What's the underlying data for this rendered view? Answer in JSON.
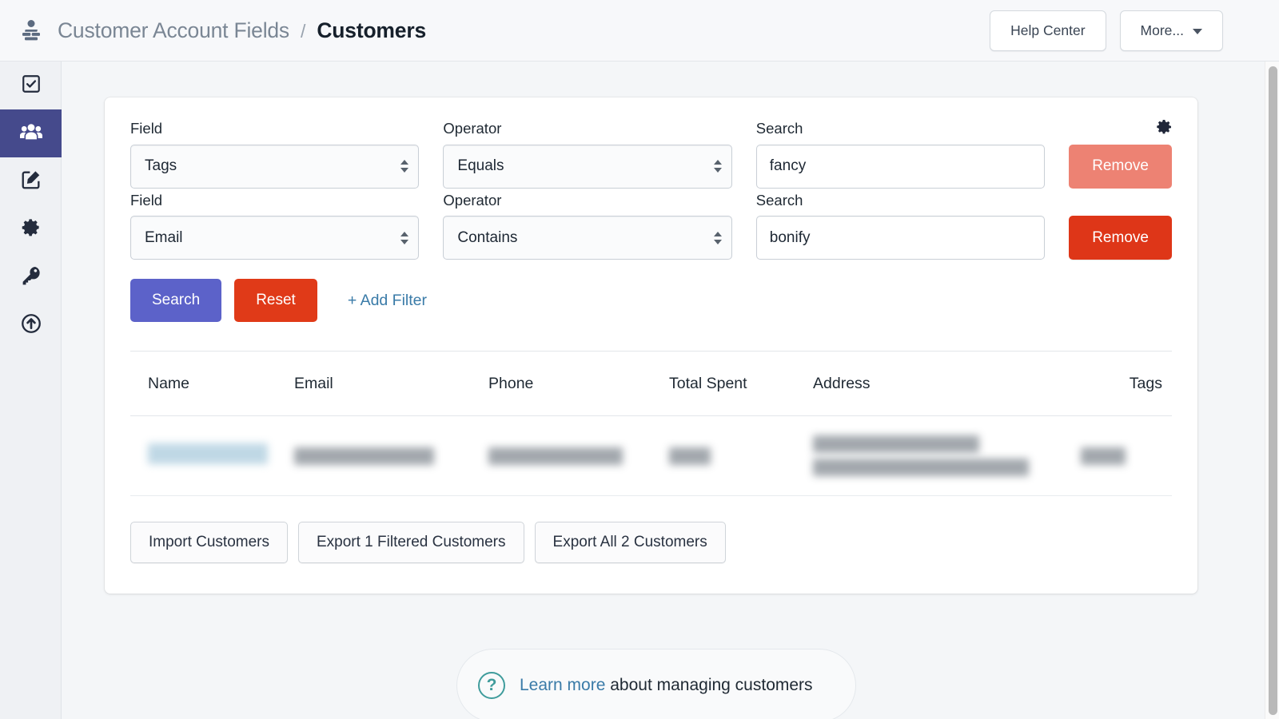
{
  "header": {
    "app_icon": "user-list-icon",
    "breadcrumb_parent": "Customer Account Fields",
    "breadcrumb_separator": "/",
    "breadcrumb_current": "Customers",
    "help_center_label": "Help Center",
    "more_label": "More...",
    "more_caret": "chevron-down-icon"
  },
  "sidebar": {
    "items": [
      {
        "name": "tasks",
        "icon": "checkbox-icon",
        "active": false
      },
      {
        "name": "customers",
        "icon": "people-icon",
        "active": true
      },
      {
        "name": "edit",
        "icon": "pencil-square-icon",
        "active": false
      },
      {
        "name": "settings",
        "icon": "gear-icon",
        "active": false
      },
      {
        "name": "permissions",
        "icon": "key-icon",
        "active": false
      },
      {
        "name": "upload",
        "icon": "upload-circle-icon",
        "active": false
      }
    ]
  },
  "card": {
    "settings_icon": "gear-icon",
    "labels": {
      "field": "Field",
      "operator": "Operator",
      "search": "Search"
    },
    "filters": [
      {
        "field_value": "Tags",
        "operator_value": "Equals",
        "search_value": "fancy",
        "remove_label": "Remove",
        "remove_style": "muted"
      },
      {
        "field_value": "Email",
        "operator_value": "Contains",
        "search_value": "bonify",
        "remove_label": "Remove",
        "remove_style": "strong"
      }
    ],
    "actions": {
      "search_label": "Search",
      "reset_label": "Reset",
      "add_filter_label": "+ Add Filter"
    },
    "table": {
      "columns": [
        "Name",
        "Email",
        "Phone",
        "Total Spent",
        "Address",
        "Tags"
      ],
      "rows": [
        {
          "name": "",
          "email": "",
          "phone": "",
          "total_spent": "",
          "address": "",
          "tags": "",
          "redacted": true
        }
      ]
    },
    "bottom_actions": [
      "Import Customers",
      "Export 1 Filtered Customers",
      "Export All 2 Customers"
    ]
  },
  "footer": {
    "help_icon": "question-circle-icon",
    "link_text": "Learn more",
    "rest_text": " about managing customers"
  },
  "colors": {
    "accent_purple": "#454a8c",
    "primary_button": "#5c62c9",
    "danger": "#de3618",
    "danger_muted": "#ed8273",
    "link": "#3a7ba8",
    "teal": "#3f9c9c",
    "page_bg": "#f4f6f8"
  }
}
